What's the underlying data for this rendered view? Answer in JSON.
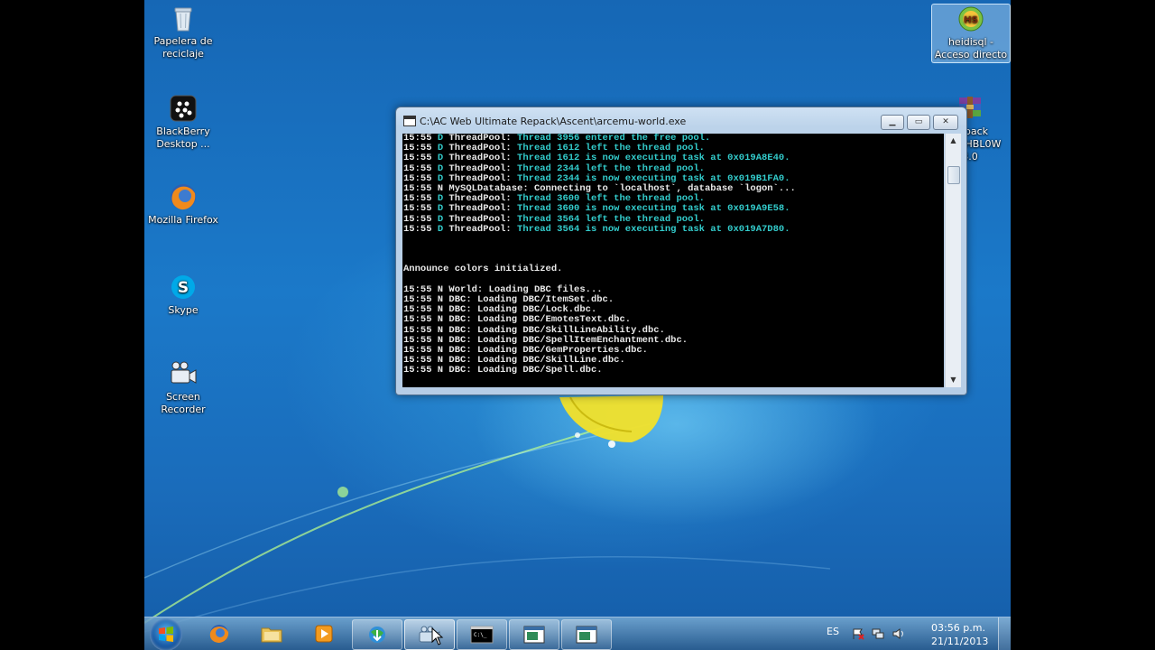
{
  "desktop": {
    "icons": [
      {
        "label": "Papelera de reciclaje",
        "icon": "recycle-bin-icon"
      },
      {
        "label": "BlackBerry Desktop ...",
        "icon": "blackberry-icon"
      },
      {
        "label": "Mozilla Firefox",
        "icon": "firefox-icon"
      },
      {
        "label": "Skype",
        "icon": "skype-icon"
      },
      {
        "label": "Screen Recorder",
        "icon": "screen-recorder-icon"
      },
      {
        "label": "heidisql - Acceso directo",
        "icon": "heidisql-icon"
      },
      {
        "label": "Repack D3ATHBL0W 3.0",
        "icon": "winrar-archive-icon"
      }
    ]
  },
  "console": {
    "title": "C:\\AC Web Ultimate Repack\\Ascent\\arcemu-world.exe",
    "lines": [
      {
        "prefix": "15:55 D ",
        "tag": "ThreadPool: ",
        "msg": "Thread 3956 entered the free pool.",
        "msg_color": "cyan"
      },
      {
        "prefix": "15:55 D ",
        "tag": "ThreadPool: ",
        "msg": "Thread 1612 left the thread pool.",
        "msg_color": "cyan"
      },
      {
        "prefix": "15:55 D ",
        "tag": "ThreadPool: ",
        "msg": "Thread 1612 is now executing task at 0x019A8E40.",
        "msg_color": "cyan"
      },
      {
        "prefix": "15:55 D ",
        "tag": "ThreadPool: ",
        "msg": "Thread 2344 left the thread pool.",
        "msg_color": "cyan"
      },
      {
        "prefix": "15:55 D ",
        "tag": "ThreadPool: ",
        "msg": "Thread 2344 is now executing task at 0x019B1FA0.",
        "msg_color": "cyan"
      },
      {
        "prefix": "15:55 N ",
        "tag": "MySQLDatabase: ",
        "msg": "Connecting to `localhost`, database `logon`...",
        "msg_color": "white"
      },
      {
        "prefix": "15:55 D ",
        "tag": "ThreadPool: ",
        "msg": "Thread 3600 left the thread pool.",
        "msg_color": "cyan"
      },
      {
        "prefix": "15:55 D ",
        "tag": "ThreadPool: ",
        "msg": "Thread 3600 is now executing task at 0x019A9E58.",
        "msg_color": "cyan"
      },
      {
        "prefix": "15:55 D ",
        "tag": "ThreadPool: ",
        "msg": "Thread 3564 left the thread pool.",
        "msg_color": "cyan"
      },
      {
        "prefix": "15:55 D ",
        "tag": "ThreadPool: ",
        "msg": "Thread 3564 is now executing task at 0x019A7D80.",
        "msg_color": "cyan"
      },
      {
        "prefix": "",
        "tag": "",
        "msg": "",
        "msg_color": "white"
      },
      {
        "prefix": "",
        "tag": "",
        "msg": "",
        "msg_color": "white"
      },
      {
        "prefix": "",
        "tag": "",
        "msg": "",
        "msg_color": "white"
      },
      {
        "prefix": "",
        "tag": "Announce colors initialized.",
        "msg": "",
        "msg_color": "white"
      },
      {
        "prefix": "",
        "tag": "",
        "msg": "",
        "msg_color": "white"
      },
      {
        "prefix": "15:55 N ",
        "tag": "World: ",
        "msg": "Loading DBC files...",
        "msg_color": "white"
      },
      {
        "prefix": "15:55 N ",
        "tag": "DBC: ",
        "msg": "Loading DBC/ItemSet.dbc.",
        "msg_color": "white"
      },
      {
        "prefix": "15:55 N ",
        "tag": "DBC: ",
        "msg": "Loading DBC/Lock.dbc.",
        "msg_color": "white"
      },
      {
        "prefix": "15:55 N ",
        "tag": "DBC: ",
        "msg": "Loading DBC/EmotesText.dbc.",
        "msg_color": "white"
      },
      {
        "prefix": "15:55 N ",
        "tag": "DBC: ",
        "msg": "Loading DBC/SkillLineAbility.dbc.",
        "msg_color": "white"
      },
      {
        "prefix": "15:55 N ",
        "tag": "DBC: ",
        "msg": "Loading DBC/SpellItemEnchantment.dbc.",
        "msg_color": "white"
      },
      {
        "prefix": "15:55 N ",
        "tag": "DBC: ",
        "msg": "Loading DBC/GemProperties.dbc.",
        "msg_color": "white"
      },
      {
        "prefix": "15:55 N ",
        "tag": "DBC: ",
        "msg": "Loading DBC/SkillLine.dbc.",
        "msg_color": "white"
      },
      {
        "prefix": "15:55 N ",
        "tag": "DBC: ",
        "msg": "Loading DBC/Spell.dbc.",
        "msg_color": "white"
      }
    ]
  },
  "taskbar": {
    "items": [
      {
        "icon": "firefox-icon",
        "state": "pinned"
      },
      {
        "icon": "file-explorer-icon",
        "state": "pinned"
      },
      {
        "icon": "media-player-icon",
        "state": "pinned"
      },
      {
        "icon": "internet-download-icon",
        "state": "open"
      },
      {
        "icon": "screen-recorder-icon",
        "state": "active"
      },
      {
        "icon": "command-prompt-icon",
        "state": "open"
      },
      {
        "icon": "console-window-icon",
        "state": "open"
      },
      {
        "icon": "console-window-icon",
        "state": "open"
      }
    ],
    "language": "ES",
    "tray_icons": [
      "notification-flag-icon",
      "network-icon",
      "speaker-icon"
    ],
    "time": "03:56 p.m.",
    "date": "21/11/2013"
  },
  "colors": {
    "console_cyan": "#33cccc",
    "console_white": "#e8e8e8",
    "console_grey": "#c0c0c0"
  }
}
